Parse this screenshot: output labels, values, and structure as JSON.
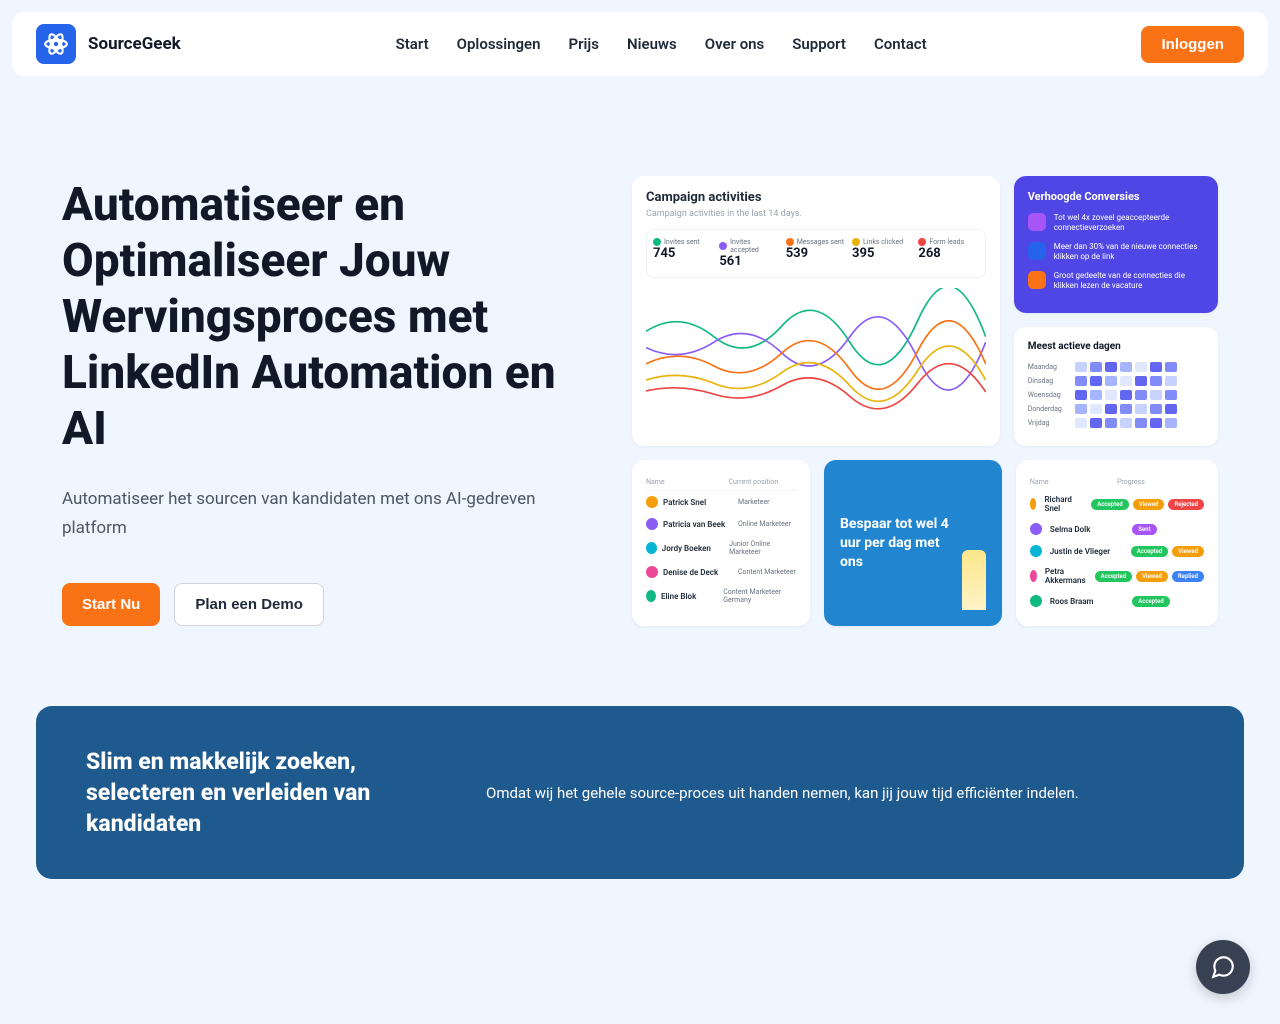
{
  "brand": "SourceGeek",
  "nav": {
    "items": [
      "Start",
      "Oplossingen",
      "Prijs",
      "Nieuws",
      "Over ons",
      "Support",
      "Contact"
    ],
    "login": "Inloggen"
  },
  "hero": {
    "title": "Automatiseer en Optimaliseer Jouw Wervingsproces met LinkedIn Automation en AI",
    "subtitle": "Automatiseer het sourcen van kandidaten met ons AI-gedreven platform",
    "cta_primary": "Start Nu",
    "cta_secondary": "Plan een Demo"
  },
  "chart_card": {
    "title": "Campaign activities",
    "subtitle": "Campaign activities in the last 14 days.",
    "stats": [
      {
        "label": "Invites sent",
        "value": "745",
        "color": "#10b981"
      },
      {
        "label": "Invites accepted",
        "value": "561",
        "color": "#8b5cf6"
      },
      {
        "label": "Messages sent",
        "value": "539",
        "color": "#f97316"
      },
      {
        "label": "Links clicked",
        "value": "395",
        "color": "#eab308"
      },
      {
        "label": "Form leads",
        "value": "268",
        "color": "#ef4444"
      }
    ]
  },
  "conversions": {
    "title": "Verhoogde Conversies",
    "items": [
      {
        "text": "Tot wel 4x zoveel geaccepteerde connectieverzoeken",
        "color": "#a855f7"
      },
      {
        "text": "Meer dan 30% van de nieuwe connecties klikken op de link",
        "color": "#2563eb"
      },
      {
        "text": "Groot gedeelte van de connecties die klikken lezen de vacature",
        "color": "#f97316"
      }
    ]
  },
  "active_days": {
    "title": "Meest actieve dagen",
    "days": [
      "Maandag",
      "Dinsdag",
      "Woensdag",
      "Donderdag",
      "Vrijdag"
    ]
  },
  "people": {
    "head_name": "Name",
    "head_pos": "Current position",
    "rows": [
      {
        "name": "Patrick Snel",
        "pos": "Marketeer",
        "color": "#f59e0b"
      },
      {
        "name": "Patricia van Beek",
        "pos": "Online Marketeer",
        "color": "#8b5cf6"
      },
      {
        "name": "Jordy Boeken",
        "pos": "Junior Online Marketeer",
        "color": "#06b6d4"
      },
      {
        "name": "Denise de Deck",
        "pos": "Content Marketeer",
        "color": "#ec4899"
      },
      {
        "name": "Eline Blok",
        "pos": "Content Marketeer Germany",
        "color": "#10b981"
      }
    ]
  },
  "blue_card": {
    "text": "Bespaar tot wel 4 uur per dag met ons"
  },
  "progress": {
    "head_name": "Name",
    "head_prog": "Progress",
    "rows": [
      {
        "name": "Richard Snel",
        "badges": [
          {
            "t": "Accepted",
            "c": "#22c55e"
          },
          {
            "t": "Viewed",
            "c": "#f59e0b"
          },
          {
            "t": "Rejected",
            "c": "#ef4444"
          }
        ],
        "color": "#f59e0b"
      },
      {
        "name": "Selma Dolk",
        "badges": [
          {
            "t": "Sent",
            "c": "#a855f7"
          }
        ],
        "color": "#8b5cf6"
      },
      {
        "name": "Justin de Vlieger",
        "badges": [
          {
            "t": "Accepted",
            "c": "#22c55e"
          },
          {
            "t": "Viewed",
            "c": "#f59e0b"
          }
        ],
        "color": "#06b6d4"
      },
      {
        "name": "Petra Akkermans",
        "badges": [
          {
            "t": "Accepted",
            "c": "#22c55e"
          },
          {
            "t": "Viewed",
            "c": "#f59e0b"
          },
          {
            "t": "Replied",
            "c": "#3b82f6"
          }
        ],
        "color": "#ec4899"
      },
      {
        "name": "Roos Braam",
        "badges": [
          {
            "t": "Accepted",
            "c": "#22c55e"
          }
        ],
        "color": "#10b981"
      }
    ]
  },
  "sub_banner": {
    "title": "Slim en makkelijk zoeken, selecteren en verleiden van kandidaten",
    "text": "Omdat wij het gehele source-proces uit handen nemen, kan jij jouw tijd efficiënter indelen."
  }
}
